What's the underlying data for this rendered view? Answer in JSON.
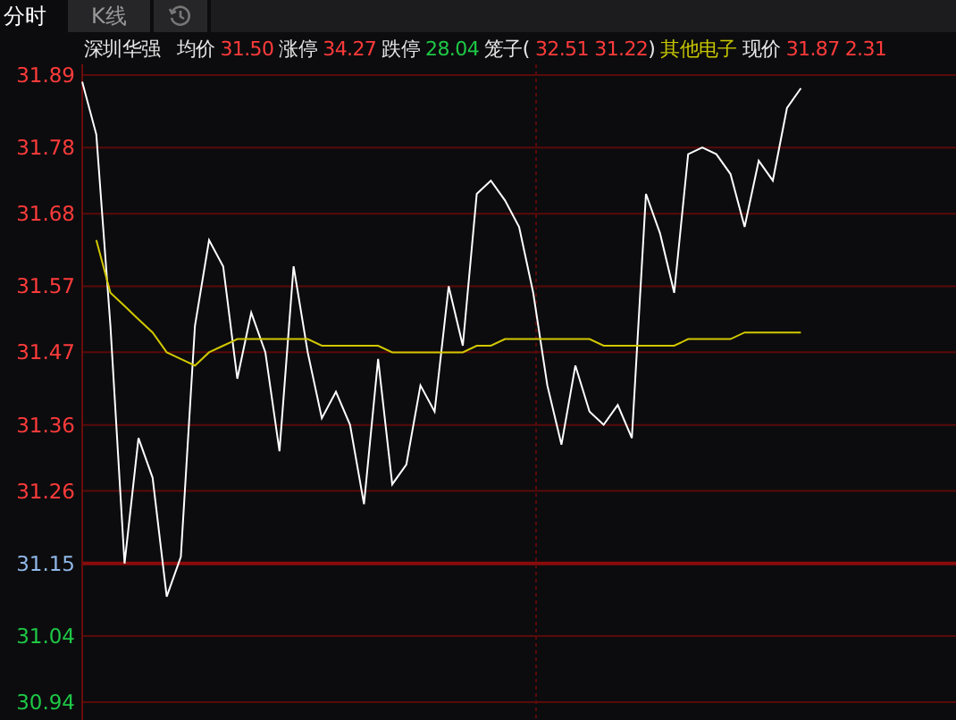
{
  "tabs": [
    {
      "kind": "text",
      "label": "分时",
      "selected": true
    },
    {
      "kind": "text",
      "label": "K线",
      "selected": false
    },
    {
      "kind": "icon",
      "selected": false
    }
  ],
  "info": [
    {
      "kind": "name",
      "text": "深圳华强",
      "color": "#e6e6e6"
    },
    {
      "kind": "label",
      "text": "均价",
      "color": "#e6e6e6"
    },
    {
      "kind": "value",
      "text": "31.50",
      "color": "#ff3b3b"
    },
    {
      "kind": "label",
      "text": "涨停",
      "color": "#e6e6e6"
    },
    {
      "kind": "value",
      "text": "34.27",
      "color": "#ff3b3b"
    },
    {
      "kind": "label",
      "text": "跌停",
      "color": "#e6e6e6"
    },
    {
      "kind": "value",
      "text": "28.04",
      "color": "#1ec846"
    },
    {
      "kind": "label",
      "text": "笼子(",
      "color": "#e6e6e6"
    },
    {
      "kind": "value",
      "text": "32.51 31.22",
      "color": "#ff3b3b"
    },
    {
      "kind": "tail",
      "text": ")",
      "color": "#e6e6e6"
    },
    {
      "kind": "label",
      "text": "其他电子",
      "color": "#c8c800"
    },
    {
      "kind": "label",
      "text": "现价",
      "color": "#e6e6e6"
    },
    {
      "kind": "value",
      "text": "31.87",
      "color": "#ff3b3b"
    },
    {
      "kind": "value",
      "text": "2.31",
      "color": "#ff3b3b"
    }
  ],
  "chart_data": {
    "type": "line",
    "grid": true,
    "ylim": [
      30.94,
      31.89
    ],
    "yticks": [
      31.89,
      31.78,
      31.68,
      31.57,
      31.47,
      31.36,
      31.26,
      31.15,
      31.04,
      30.94
    ],
    "ref_lines": [
      {
        "axis": "y",
        "value": 31.15
      }
    ],
    "series": [
      {
        "color": "#ffffff",
        "values": [
          31.88,
          31.8,
          31.51,
          31.15,
          31.34,
          31.28,
          31.1,
          31.16,
          31.51,
          31.64,
          31.6,
          31.43,
          31.53,
          31.47,
          31.32,
          31.6,
          31.47,
          31.37,
          31.41,
          31.36,
          31.24,
          31.46,
          31.27,
          31.3,
          31.42,
          31.38,
          31.57,
          31.48,
          31.71,
          31.73,
          31.7,
          31.66,
          31.56,
          31.42,
          31.33,
          31.45,
          31.38,
          31.36,
          31.39,
          31.34,
          31.71,
          31.65,
          31.56,
          31.77,
          31.78,
          31.77,
          31.74,
          31.66,
          31.76,
          31.73,
          31.84,
          31.87
        ]
      },
      {
        "color": "#d2c800",
        "values": [
          null,
          31.64,
          31.56,
          31.54,
          31.52,
          31.5,
          31.47,
          31.46,
          31.45,
          31.47,
          31.48,
          31.49,
          31.49,
          31.49,
          31.49,
          31.49,
          31.49,
          31.48,
          31.48,
          31.48,
          31.48,
          31.48,
          31.47,
          31.47,
          31.47,
          31.47,
          31.47,
          31.47,
          31.48,
          31.48,
          31.49,
          31.49,
          31.49,
          31.49,
          31.49,
          31.49,
          31.49,
          31.48,
          31.48,
          31.48,
          31.48,
          31.48,
          31.48,
          31.49,
          31.49,
          31.49,
          31.49,
          31.5,
          31.5,
          31.5,
          31.5,
          31.5
        ]
      }
    ]
  }
}
